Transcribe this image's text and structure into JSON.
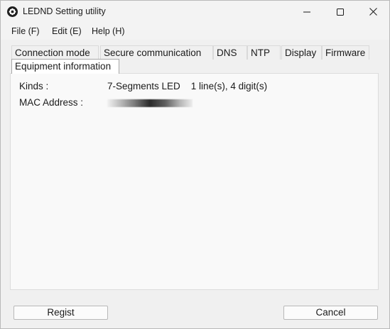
{
  "window": {
    "title": "LEDND Setting utility",
    "icon": "gear-icon"
  },
  "menu": {
    "file": "File (F)",
    "edit": "Edit (E)",
    "help": "Help (H)"
  },
  "tabs": [
    {
      "label": "Connection mode",
      "active": false
    },
    {
      "label": "Secure communication",
      "active": false
    },
    {
      "label": "DNS",
      "active": false
    },
    {
      "label": "NTP",
      "active": false
    },
    {
      "label": "Display",
      "active": false
    },
    {
      "label": "Firmware",
      "active": false
    },
    {
      "label": "Equipment information",
      "active": true
    }
  ],
  "equipment": {
    "kinds_label": "Kinds :",
    "kinds_value": "7-Segments LED    1 line(s), 4 digit(s)",
    "mac_label": "MAC Address :"
  },
  "buttons": {
    "regist": "Regist",
    "cancel": "Cancel"
  }
}
